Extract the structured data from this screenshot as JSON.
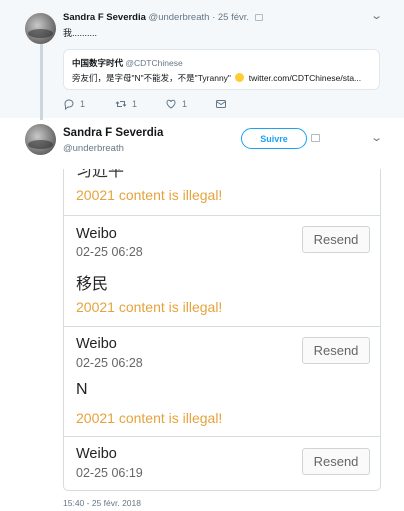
{
  "tweet1": {
    "name": "Sandra F Severdia",
    "handle": "@underbreath",
    "dot": "·",
    "date": "25 févr.",
    "text": "我..........",
    "quote": {
      "name": "中国数字时代",
      "handle": "@CDTChinese",
      "text_before": "旁友们，是字母\"N\"不能发，不是\"Tyranny\"",
      "text_after": "twitter.com/CDTChinese/sta..."
    },
    "actions": {
      "reply_count": "1",
      "retweet_count": "1",
      "like_count": "1"
    }
  },
  "tweet2": {
    "name": "Sandra F Severdia",
    "handle": "@underbreath",
    "follow_label": "Suivre",
    "timestamp": "15:40 - 25 févr. 2018"
  },
  "screenshot": {
    "cut_text": "习近平",
    "illegal_text": "20021 content is illegal!",
    "messages": [
      {
        "source": "Weibo",
        "time": "02-25 06:28",
        "resend_label": "Resend",
        "content": "移民"
      },
      {
        "source": "Weibo",
        "time": "02-25 06:28",
        "resend_label": "Resend",
        "content": "N"
      },
      {
        "source": "Weibo",
        "time": "02-25 06:19",
        "resend_label": "Resend"
      }
    ]
  },
  "colors": {
    "accent": "#1da1f2",
    "warning": "#e6a23c",
    "muted": "#657786"
  },
  "icons": [
    "reply-icon",
    "retweet-icon",
    "like-icon",
    "direct-message-icon",
    "chevron-down-icon",
    "translate-badge-icon",
    "emoji-icon"
  ]
}
